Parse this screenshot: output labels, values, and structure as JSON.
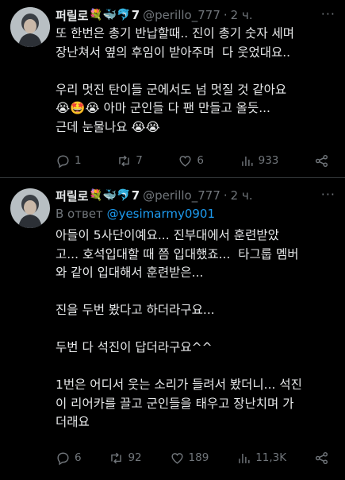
{
  "tweets": [
    {
      "author_name": "퍼릴로",
      "author_emoji": "💐🐳🐬",
      "author_suffix": "7",
      "handle": "@perillo_777",
      "separator": "·",
      "time": "2 ч.",
      "more": "···",
      "body": "또 한번은 총기 반납할때.. 진이 총기 숫자 세며\n장난쳐서 옆의 후임이 받아주며  다 웃었대요..\n\n우리 멋진 탄이들 군에서도 넘 멋질 것 같아요\n😭🤩😭 아마 군인들 다 팬 만들고 올듯...\n근데 눈물나요 😭😭",
      "actions": {
        "replies": "1",
        "retweets": "7",
        "likes": "6",
        "views": "933"
      }
    },
    {
      "author_name": "퍼릴로",
      "author_emoji": "💐🐳🐬",
      "author_suffix": "7",
      "handle": "@perillo_777",
      "separator": "·",
      "time": "2 ч.",
      "more": "···",
      "reply_prefix": "В ответ ",
      "reply_mention": "@yesimarmy0901",
      "body": "아들이 5사단이예요... 진부대에서 훈련받았\n고... 호석입대할 때 쯤 입대했죠...  타그룹 멤버\n와 같이 입대해서 훈련받은...\n\n진을 두번 봤다고 하더라구요...\n\n두번 다 석진이 답더라구요^^\n\n1번은 어디서 웃는 소리가 들려서 봤더니... 석진\n이 리어카를 끌고 군인들을 태우고 장난치며 가\n더래요",
      "actions": {
        "replies": "6",
        "retweets": "92",
        "likes": "189",
        "views": "11,3K"
      }
    }
  ],
  "colors": {
    "background": "#000000",
    "text": "#e7e9ea",
    "muted": "#71767b",
    "link": "#1d9bf0",
    "divider": "#2f3336"
  }
}
